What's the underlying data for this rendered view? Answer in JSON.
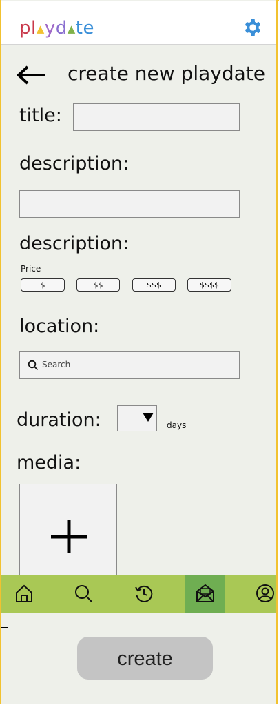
{
  "app": {
    "logo_text": "playdate",
    "logo_letters": [
      {
        "ch": "p",
        "color": "#c93a4c"
      },
      {
        "ch": "l",
        "color": "#c93a4c"
      },
      {
        "ch": "▲",
        "color": "#f2c230"
      },
      {
        "ch": "y",
        "color": "#a06ac8"
      },
      {
        "ch": "d",
        "color": "#8a6fd0"
      },
      {
        "ch": "▲",
        "color": "#7fb24a"
      },
      {
        "ch": "t",
        "color": "#3a8fd8"
      },
      {
        "ch": "e",
        "color": "#3a8fd8"
      }
    ],
    "settings_icon": "gear-icon",
    "accent_color": "#3a8fd8"
  },
  "screen": {
    "title": "create new playdate",
    "back_icon": "arrow-left-icon"
  },
  "form": {
    "title_label": "title:",
    "title_value": "",
    "description_label": "description:",
    "description_value": "",
    "price_section_label": "description:",
    "price_label": "Price",
    "price_options": [
      "$",
      "$$",
      "$$$",
      "$$$$"
    ],
    "location_label": "location:",
    "location_placeholder": "Search",
    "duration_label": "duration:",
    "duration_value": "",
    "duration_unit": "days",
    "media_label": "media:",
    "add_media_icon": "plus-icon"
  },
  "nav": {
    "items": [
      {
        "name": "home",
        "icon": "home-icon"
      },
      {
        "name": "search",
        "icon": "search-icon"
      },
      {
        "name": "history",
        "icon": "history-icon"
      },
      {
        "name": "inbox",
        "icon": "envelope-open-icon",
        "active": true
      },
      {
        "name": "profile",
        "icon": "user-circle-icon"
      }
    ],
    "bar_color": "#a9c855",
    "active_color": "#6fae52"
  },
  "actions": {
    "create_label": "create"
  }
}
